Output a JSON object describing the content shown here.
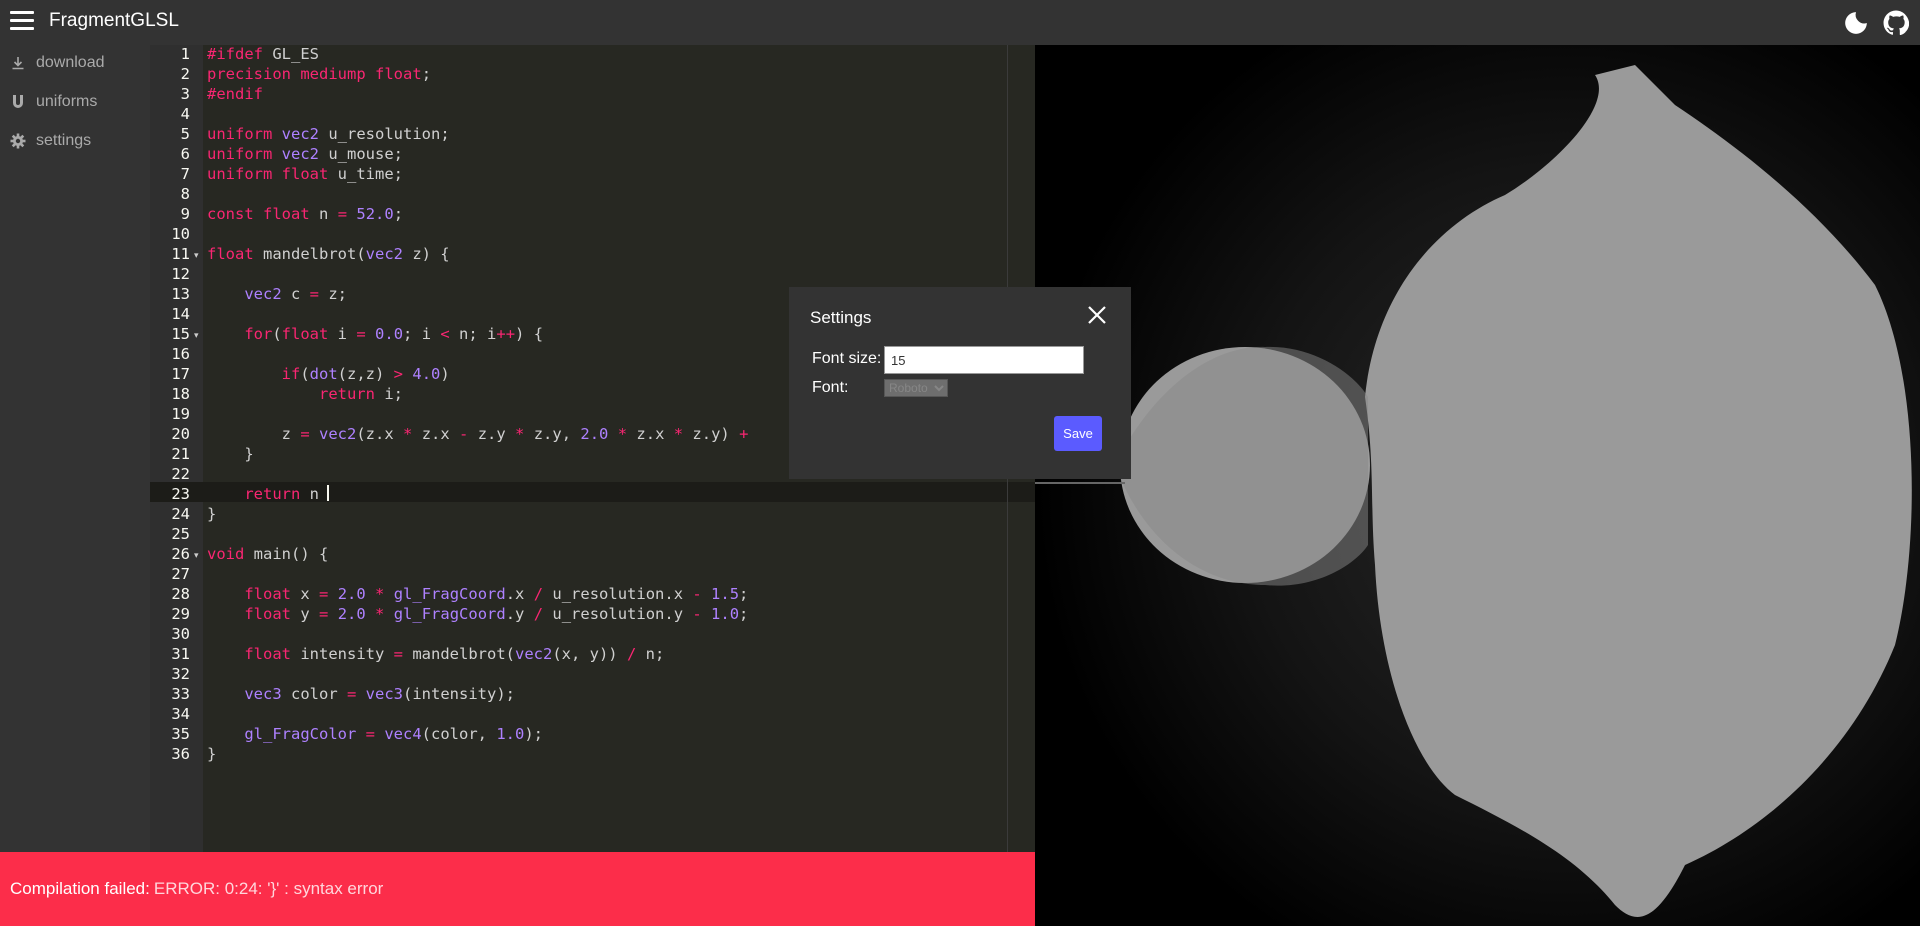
{
  "app": {
    "title": "FragmentGLSL",
    "icons": [
      "menu-icon",
      "moon-icon",
      "github-icon"
    ]
  },
  "sidebar": {
    "items": [
      {
        "label": "download",
        "icon": "download-icon"
      },
      {
        "label": "uniforms",
        "icon": "uniforms-u-icon"
      },
      {
        "label": "settings",
        "icon": "gear-icon"
      }
    ]
  },
  "editor": {
    "lines": [
      "#ifdef GL_ES",
      "precision mediump float;",
      "#endif",
      "",
      "uniform vec2 u_resolution;",
      "uniform vec2 u_mouse;",
      "uniform float u_time;",
      "",
      "const float n = 52.0;",
      "",
      "float mandelbrot(vec2 z) {",
      "",
      "    vec2 c = z;",
      "",
      "    for(float i = 0.0; i < n; i++) {",
      "",
      "        if(dot(z,z) > 4.0)",
      "            return i;",
      "",
      "        z = vec2(z.x * z.x - z.y * z.y, 2.0 * z.x * z.y) +",
      "    }",
      "",
      "    return n",
      "}",
      "",
      "void main() {",
      "",
      "    float x = 2.0 * gl_FragCoord.x / u_resolution.x - 1.5;",
      "    float y = 2.0 * gl_FragCoord.y / u_resolution.y - 1.0;",
      "",
      "    float intensity = mandelbrot(vec2(x, y)) / n;",
      "",
      "    vec3 color = vec3(intensity);",
      "",
      "    gl_FragColor = vec4(color, 1.0);",
      "}"
    ]
  },
  "error": {
    "label": "Compilation failed:",
    "message": "ERROR: 0:24: '}' : syntax error"
  },
  "settings_modal": {
    "title": "Settings",
    "font_size_label": "Font size:",
    "font_size_value": "15",
    "font_label": "Font:",
    "font_value": "Roboto",
    "save_label": "Save"
  },
  "colors": {
    "topbar": "#333333",
    "editor_bg": "#272822",
    "error_bg": "#fc2d4a",
    "save_button": "#5b5bff",
    "keyword": "#f92672",
    "number": "#ae81ff"
  }
}
